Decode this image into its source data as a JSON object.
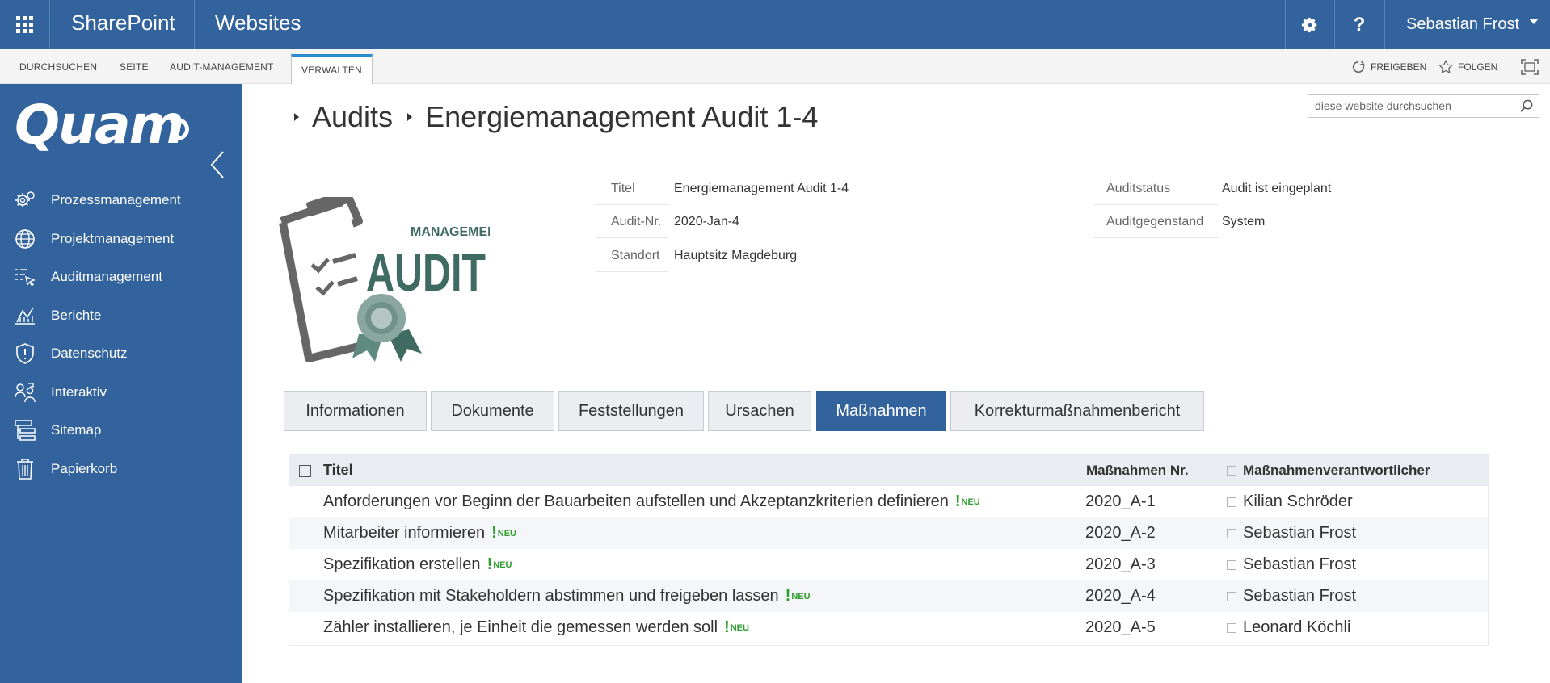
{
  "suitebar": {
    "brand": "SharePoint",
    "site": "Websites",
    "settings_icon": "gear-icon",
    "help_label": "?",
    "user_name": "Sebastian Frost"
  },
  "ribbon": {
    "tabs": [
      "DURCHSUCHEN",
      "SEITE",
      "AUDIT-MANAGEMENT",
      "VERWALTEN"
    ],
    "active_tab": "VERWALTEN",
    "share_label": "FREIGEBEN",
    "follow_label": "FOLGEN"
  },
  "leftnav": {
    "logo_text": "Quam",
    "items": [
      {
        "label": "Prozessmanagement",
        "icon": "gears-icon"
      },
      {
        "label": "Projektmanagement",
        "icon": "globe-icon"
      },
      {
        "label": "Auditmanagement",
        "icon": "checklist-cursor-icon"
      },
      {
        "label": "Berichte",
        "icon": "chart-icon"
      },
      {
        "label": "Datenschutz",
        "icon": "shield-icon"
      },
      {
        "label": "Interaktiv",
        "icon": "people-icon"
      },
      {
        "label": "Sitemap",
        "icon": "sitemap-icon"
      },
      {
        "label": "Papierkorb",
        "icon": "trash-icon"
      }
    ]
  },
  "breadcrumb": {
    "parent": "Audits",
    "current": "Energiemanagement Audit 1-4"
  },
  "search": {
    "placeholder": "diese website durchsuchen"
  },
  "audit_logo": {
    "top_text": "MANAGEMENT",
    "main_text": "AUDIT"
  },
  "fields": {
    "left": [
      {
        "label": "Titel",
        "value": "Energiemanagement Audit 1-4"
      },
      {
        "label": "Audit-Nr.",
        "value": "2020-Jan-4"
      },
      {
        "label": "Standort",
        "value": "Hauptsitz Magdeburg"
      }
    ],
    "right": [
      {
        "label": "Auditstatus",
        "value": "Audit ist eingeplant"
      },
      {
        "label": "Auditgegenstand",
        "value": "System"
      }
    ]
  },
  "tabs": [
    "Informationen",
    "Dokumente",
    "Feststellungen",
    "Ursachen",
    "Maßnahmen",
    "Korrekturmaßnahmenbericht"
  ],
  "active_tab": "Maßnahmen",
  "table": {
    "headers": [
      "Titel",
      "Maßnahmen Nr.",
      "Maßnahmenverantwortlicher"
    ],
    "new_badge": "NEU",
    "rows": [
      {
        "title": "Anforderungen vor Beginn der Bauarbeiten aufstellen und Akzeptanzkriterien definieren",
        "nr": "2020_A-1",
        "owner": "Kilian Schröder"
      },
      {
        "title": "Mitarbeiter informieren",
        "nr": "2020_A-2",
        "owner": "Sebastian Frost"
      },
      {
        "title": "Spezifikation erstellen",
        "nr": "2020_A-3",
        "owner": "Sebastian Frost"
      },
      {
        "title": "Spezifikation mit Stakeholdern abstimmen und freigeben lassen",
        "nr": "2020_A-4",
        "owner": "Sebastian Frost"
      },
      {
        "title": "Zähler installieren, je Einheit die gemessen werden soll",
        "nr": "2020_A-5",
        "owner": "Leonard Köchli"
      }
    ]
  },
  "colors": {
    "brand_blue": "#33639d",
    "accent_teal": "#2a8dd4",
    "new_green": "#2e9e2e",
    "logo_gray": "#666666",
    "logo_green": "#3f6b62"
  }
}
